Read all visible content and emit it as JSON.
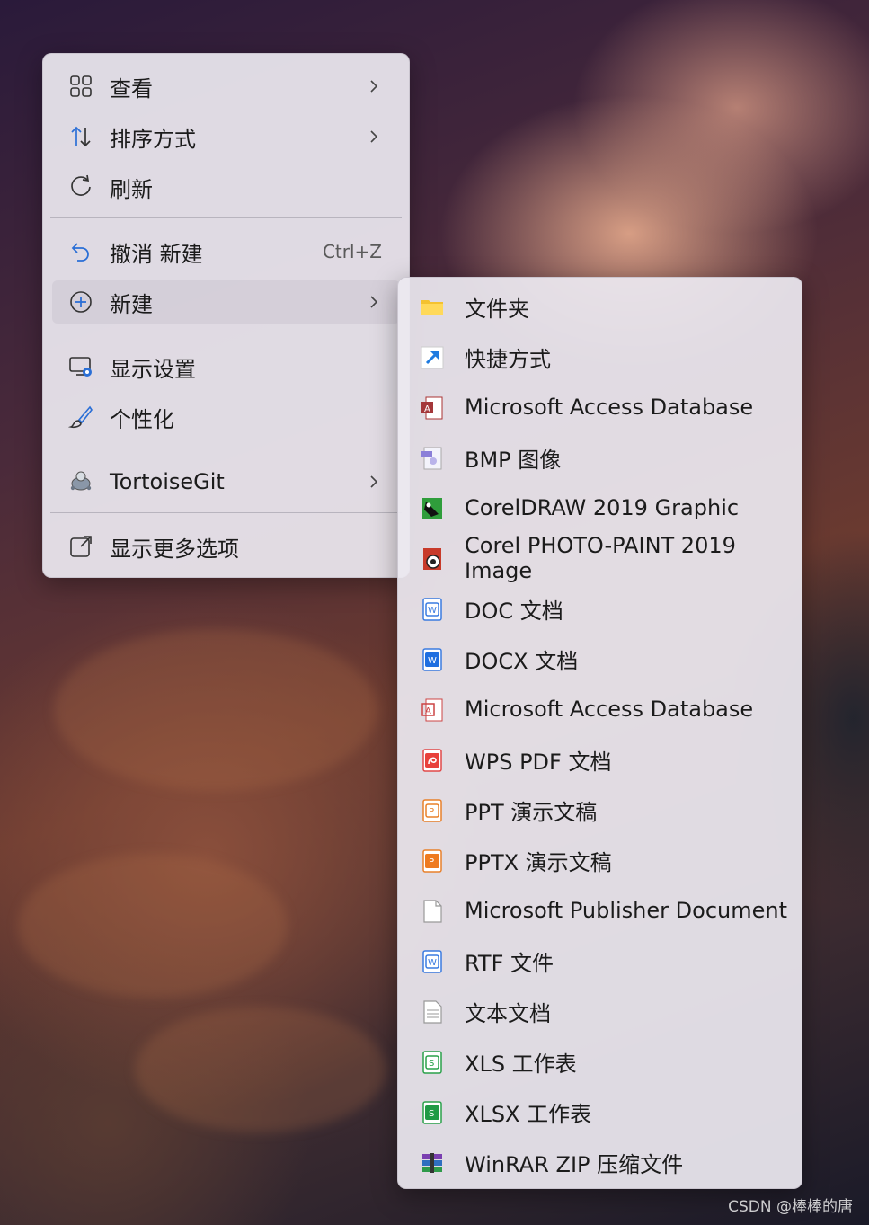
{
  "main_menu": {
    "items": [
      {
        "label": "查看",
        "icon": "grid-icon",
        "submenu": true
      },
      {
        "label": "排序方式",
        "icon": "sort-icon",
        "submenu": true
      },
      {
        "label": "刷新",
        "icon": "refresh-icon",
        "submenu": false
      },
      {
        "label": "撤消 新建",
        "icon": "undo-icon",
        "shortcut": "Ctrl+Z",
        "submenu": false
      },
      {
        "label": "新建",
        "icon": "add-circle-icon",
        "submenu": true
      },
      {
        "label": "显示设置",
        "icon": "display-settings-icon",
        "submenu": false
      },
      {
        "label": "个性化",
        "icon": "brush-icon",
        "submenu": false
      },
      {
        "label": "TortoiseGit",
        "icon": "tortoisegit-icon",
        "submenu": true
      },
      {
        "label": "显示更多选项",
        "icon": "more-options-icon",
        "submenu": false
      }
    ]
  },
  "new_submenu": {
    "items": [
      {
        "label": "文件夹",
        "icon": "folder-icon"
      },
      {
        "label": "快捷方式",
        "icon": "shortcut-icon"
      },
      {
        "label": "Microsoft Access Database",
        "icon": "access-icon"
      },
      {
        "label": "BMP 图像",
        "icon": "bmp-image-icon"
      },
      {
        "label": "CorelDRAW 2019 Graphic",
        "icon": "coreldraw-icon"
      },
      {
        "label": "Corel PHOTO-PAINT 2019 Image",
        "icon": "photopaint-icon"
      },
      {
        "label": "DOC 文档",
        "icon": "doc-icon"
      },
      {
        "label": "DOCX 文档",
        "icon": "docx-icon"
      },
      {
        "label": "Microsoft Access Database",
        "icon": "access-icon-alt"
      },
      {
        "label": "WPS PDF 文档",
        "icon": "pdf-icon"
      },
      {
        "label": "PPT 演示文稿",
        "icon": "ppt-icon"
      },
      {
        "label": "PPTX 演示文稿",
        "icon": "pptx-icon"
      },
      {
        "label": "Microsoft Publisher Document",
        "icon": "blank-file-icon"
      },
      {
        "label": "RTF 文件",
        "icon": "rtf-icon"
      },
      {
        "label": "文本文档",
        "icon": "text-file-icon"
      },
      {
        "label": "XLS 工作表",
        "icon": "xls-icon"
      },
      {
        "label": "XLSX 工作表",
        "icon": "xlsx-icon"
      },
      {
        "label": "WinRAR ZIP 压缩文件",
        "icon": "winrar-icon"
      }
    ]
  },
  "watermark": "CSDN @棒棒的唐",
  "colors": {
    "menu_bg": "#ECE8F0",
    "accent_blue": "#2B6FD6",
    "folder_yellow": "#F4C230"
  }
}
